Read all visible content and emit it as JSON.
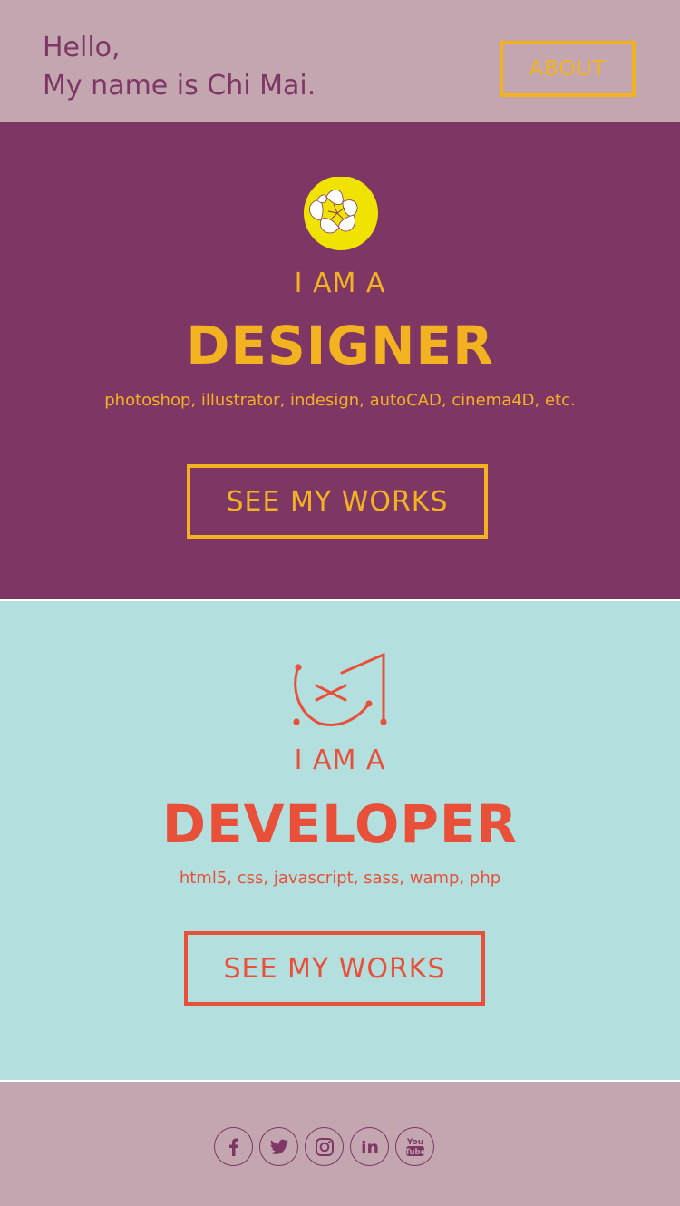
{
  "header": {
    "greeting_line1": "Hello,",
    "greeting_line2": "My name is Chi Mai.",
    "about_label": "ABOUT"
  },
  "designer": {
    "logo_icon": "flower-icon",
    "i_am": "I AM A",
    "role": "DESIGNER",
    "skills": "photoshop, illustrator, indesign, autoCAD, cinema4D, etc.",
    "works_label": "SEE MY WORKS"
  },
  "developer": {
    "logo_icon": "developer-monogram-icon",
    "i_am": "I AM A",
    "role": "DEVELOPER",
    "skills": "html5, css, javascript, sass, wamp, php",
    "works_label": "SEE MY WORKS"
  },
  "footer": {
    "socials": [
      {
        "name": "facebook",
        "icon": "facebook-icon"
      },
      {
        "name": "twitter",
        "icon": "twitter-icon"
      },
      {
        "name": "instagram",
        "icon": "instagram-icon"
      },
      {
        "name": "linkedin",
        "icon": "linkedin-icon",
        "text": "in"
      },
      {
        "name": "youtube",
        "icon": "youtube-icon",
        "text_top": "You",
        "text_bottom": "Tube"
      }
    ]
  },
  "colors": {
    "plum": "#7e3664",
    "mauve": "#c3a6b0",
    "gold": "#f3b321",
    "teal": "#b3e0df",
    "coral": "#e8503a",
    "sun": "#f1e300"
  }
}
